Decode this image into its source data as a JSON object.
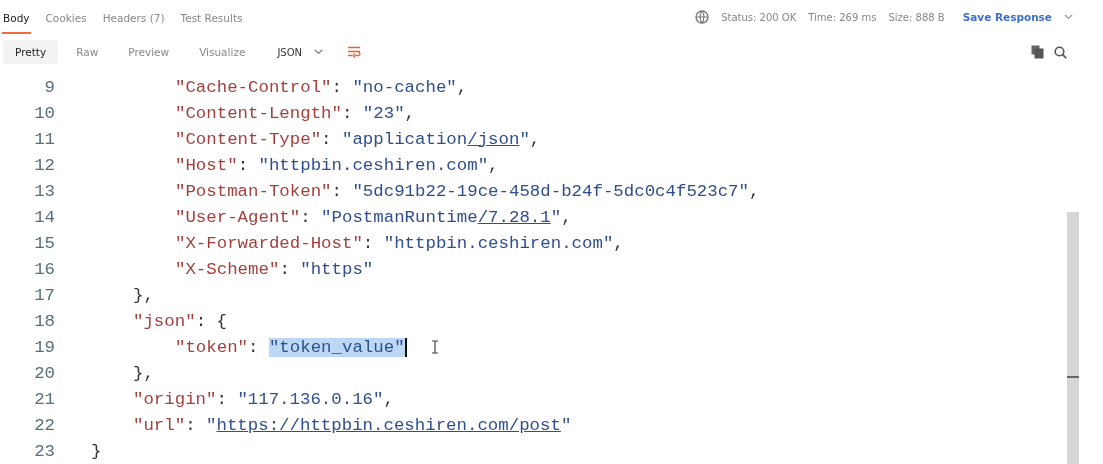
{
  "tabs": [
    {
      "label": "Body",
      "selected": true
    },
    {
      "label": "Cookies",
      "selected": false
    },
    {
      "label": "Headers (7)",
      "selected": false
    },
    {
      "label": "Test Results",
      "selected": false
    }
  ],
  "status": {
    "status": "Status: 200 OK",
    "time": "Time: 269 ms",
    "size": "Size: 888 B",
    "save": "Save Response"
  },
  "views": [
    {
      "label": "Pretty",
      "selected": true
    },
    {
      "label": "Raw",
      "selected": false
    },
    {
      "label": "Preview",
      "selected": false
    },
    {
      "label": "Visualize",
      "selected": false
    }
  ],
  "format": "JSON",
  "lines": [
    {
      "children": [
        {
          "children": [
            {
              "number": "9",
              "tokens": [
                {
                  "kind": "key",
                  "text": "\"Cache-Control\""
                },
                {
                  "kind": "punct",
                  "text": ": "
                },
                {
                  "kind": "str",
                  "text": "\"no-cache\""
                },
                {
                  "kind": "punct",
                  "text": ","
                }
              ]
            },
            {
              "number": "10",
              "tokens": [
                {
                  "kind": "key",
                  "text": "\"Content-Length\""
                },
                {
                  "kind": "punct",
                  "text": ": "
                },
                {
                  "kind": "str",
                  "text": "\"23\""
                },
                {
                  "kind": "punct",
                  "text": ","
                }
              ]
            },
            {
              "number": "11",
              "tokens": [
                {
                  "kind": "key",
                  "text": "\"Content-Type\""
                },
                {
                  "kind": "punct",
                  "text": ": "
                },
                {
                  "kind": "str",
                  "text": "\"application"
                },
                {
                  "kind": "link",
                  "text": "/json"
                },
                {
                  "kind": "str",
                  "text": "\""
                },
                {
                  "kind": "punct",
                  "text": ","
                }
              ]
            },
            {
              "number": "12",
              "tokens": [
                {
                  "kind": "key",
                  "text": "\"Host\""
                },
                {
                  "kind": "punct",
                  "text": ": "
                },
                {
                  "kind": "str",
                  "text": "\"httpbin.ceshiren.com\""
                },
                {
                  "kind": "punct",
                  "text": ","
                }
              ]
            },
            {
              "number": "13",
              "tokens": [
                {
                  "kind": "key",
                  "text": "\"Postman-Token\""
                },
                {
                  "kind": "punct",
                  "text": ": "
                },
                {
                  "kind": "str",
                  "text": "\"5dc91b22-19ce-458d-b24f-5dc0c4f523c7\""
                },
                {
                  "kind": "punct",
                  "text": ","
                }
              ]
            },
            {
              "number": "14",
              "tokens": [
                {
                  "kind": "key",
                  "text": "\"User-Agent\""
                },
                {
                  "kind": "punct",
                  "text": ": "
                },
                {
                  "kind": "str",
                  "text": "\"PostmanRuntime"
                },
                {
                  "kind": "link",
                  "text": "/7.28.1"
                },
                {
                  "kind": "str",
                  "text": "\""
                },
                {
                  "kind": "punct",
                  "text": ","
                }
              ]
            },
            {
              "number": "15",
              "tokens": [
                {
                  "kind": "key",
                  "text": "\"X-Forwarded-Host\""
                },
                {
                  "kind": "punct",
                  "text": ": "
                },
                {
                  "kind": "str",
                  "text": "\"httpbin.ceshiren.com\""
                },
                {
                  "kind": "punct",
                  "text": ","
                }
              ]
            },
            {
              "number": "16",
              "tokens": [
                {
                  "kind": "key",
                  "text": "\"X-Scheme\""
                },
                {
                  "kind": "punct",
                  "text": ": "
                },
                {
                  "kind": "str",
                  "text": "\"https\""
                }
              ]
            }
          ]
        },
        {
          "number": "17",
          "tokens": [
            {
              "kind": "punct",
              "text": "},"
            }
          ]
        },
        {
          "number": "18",
          "tokens": [
            {
              "kind": "key",
              "text": "\"json\""
            },
            {
              "kind": "punct",
              "text": ": {"
            }
          ]
        },
        {
          "children": [
            {
              "number": "19",
              "tokens": [
                {
                  "kind": "key",
                  "text": "\"token\""
                },
                {
                  "kind": "punct",
                  "text": ": "
                },
                {
                  "kind": "selected",
                  "text": "\"token_value\""
                }
              ]
            }
          ]
        },
        {
          "number": "20",
          "tokens": [
            {
              "kind": "punct",
              "text": "},"
            }
          ]
        },
        {
          "number": "21",
          "tokens": [
            {
              "kind": "key",
              "text": "\"origin\""
            },
            {
              "kind": "punct",
              "text": ": "
            },
            {
              "kind": "str",
              "text": "\"117.136.0.16\""
            },
            {
              "kind": "punct",
              "text": ","
            }
          ]
        },
        {
          "number": "22",
          "tokens": [
            {
              "kind": "key",
              "text": "\"url\""
            },
            {
              "kind": "punct",
              "text": ": "
            },
            {
              "kind": "str",
              "text": "\""
            },
            {
              "kind": "link",
              "text": "https://httpbin.ceshiren.com/post"
            },
            {
              "kind": "str",
              "text": "\""
            }
          ]
        }
      ]
    },
    {
      "number": "23",
      "tokens": [
        {
          "kind": "punct",
          "text": "}"
        }
      ]
    }
  ]
}
